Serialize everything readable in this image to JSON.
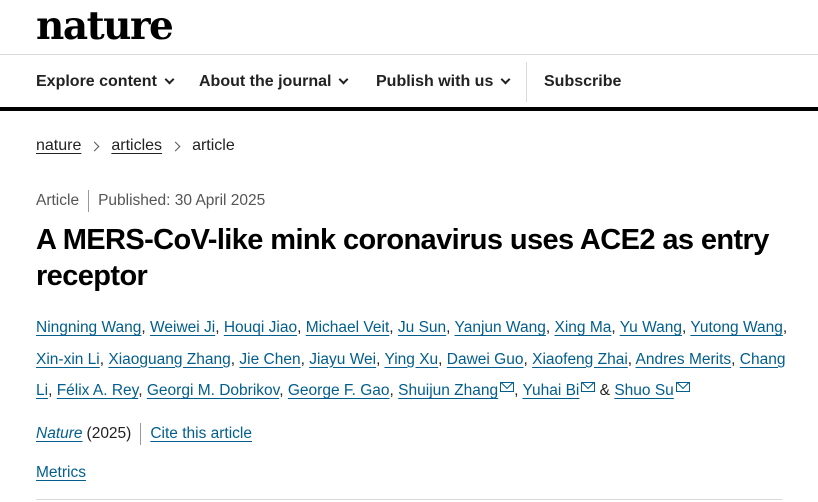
{
  "brand": {
    "logo": "nature"
  },
  "nav": {
    "items": [
      {
        "label": "Explore content"
      },
      {
        "label": "About the journal"
      },
      {
        "label": "Publish with us"
      }
    ],
    "subscribe": "Subscribe"
  },
  "breadcrumb": [
    {
      "label": "nature"
    },
    {
      "label": "articles"
    },
    {
      "label": "article"
    }
  ],
  "article": {
    "type": "Article",
    "published": "Published: 30 April 2025",
    "title": "A MERS-CoV-like mink coronavirus uses ACE2 as entry receptor",
    "authors": [
      "Ningning Wang",
      "Weiwei Ji",
      "Houqi Jiao",
      "Michael Veit",
      "Ju Sun",
      "Yanjun Wang",
      "Xing Ma",
      "Yu Wang",
      "Yutong Wang",
      "Xin-xin Li",
      "Xiaoguang Zhang",
      "Jie Chen",
      "Jiayu Wei",
      "Ying Xu",
      "Dawei Guo",
      "Xiaofeng Zhai",
      "Andres Merits",
      "Chang Li",
      "Félix A. Rey",
      "Georgi M. Dobrikov",
      "George F. Gao",
      "Shuijun Zhang",
      "Yuhai Bi",
      "Shuo Su"
    ],
    "author_separator": ", ",
    "author_final_separator": " & ",
    "journal": "Nature",
    "year": "(2025)",
    "cite": "Cite this article",
    "metrics": "Metrics"
  },
  "icons": {
    "nav_dropdown": "chevron-down-icon",
    "breadcrumb_sep": "chevron-right-icon",
    "corresponding_author": "mail-icon"
  },
  "colors": {
    "link": "#025e8d",
    "text": "#222222",
    "rule": "#000000"
  }
}
